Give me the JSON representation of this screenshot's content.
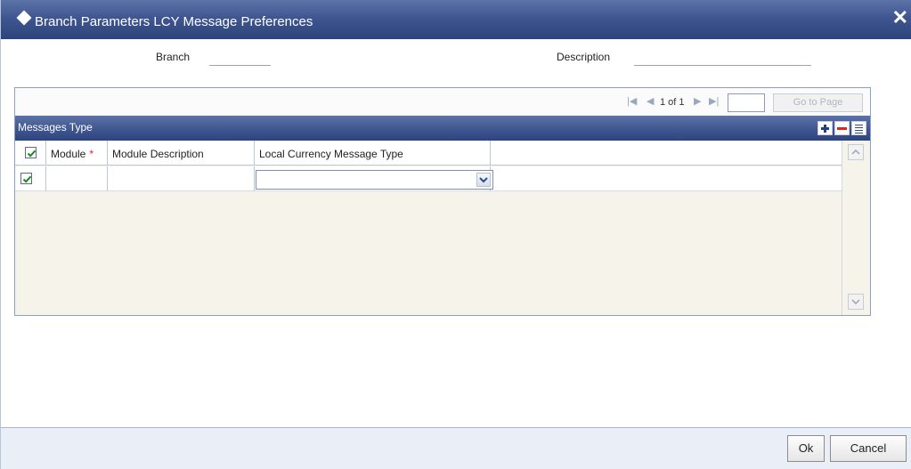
{
  "window": {
    "title": "Branch Parameters LCY Message Preferences"
  },
  "header": {
    "branch_label": "Branch",
    "branch_value": "",
    "description_label": "Description",
    "description_value": ""
  },
  "pager": {
    "page_text": "1 of 1",
    "page_input_value": "",
    "go_button_label": "Go to Page"
  },
  "grid": {
    "title": "Messages Type",
    "columns": [
      {
        "label": "Module",
        "required": true
      },
      {
        "label": "Module Description",
        "required": false
      },
      {
        "label": "Local Currency Message Type",
        "required": false
      }
    ],
    "rows": [
      {
        "checked": true,
        "module": "",
        "module_description": "",
        "local_currency_message_type": ""
      }
    ],
    "header_checked": true
  },
  "footer": {
    "ok_label": "Ok",
    "cancel_label": "Cancel"
  },
  "colors": {
    "title_bar": "#3f5690",
    "required_marker": "#e2241d",
    "grid_background": "#f5f3ea",
    "footer_background": "#e9eef7"
  }
}
